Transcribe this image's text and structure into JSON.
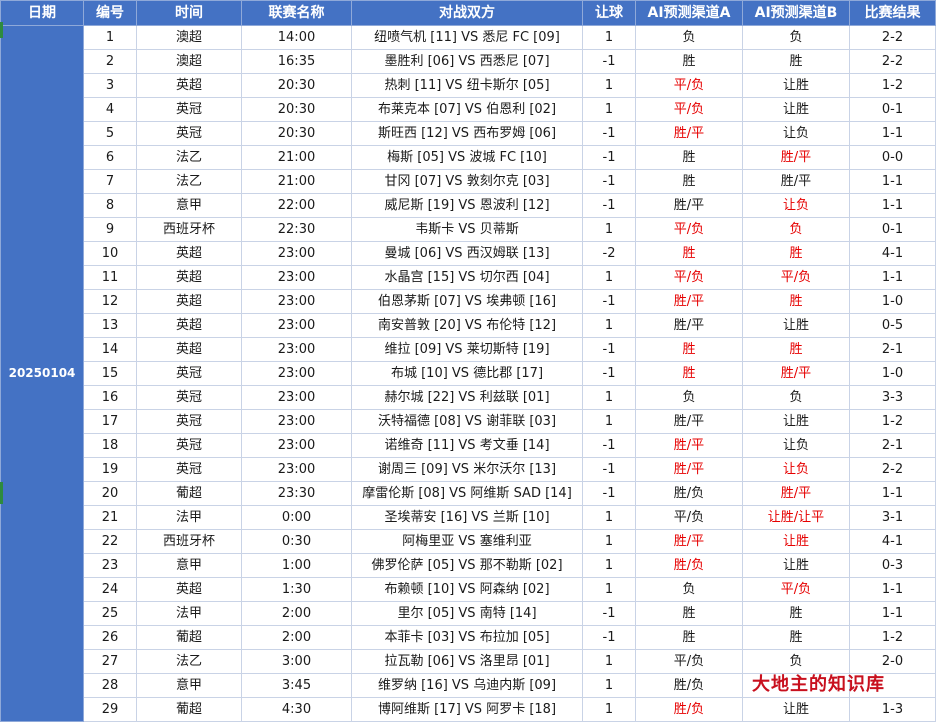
{
  "headers": [
    "日期",
    "编号",
    "时间",
    "联赛名称",
    "对战双方",
    "让球",
    "AI预测渠道A",
    "AI预测渠道B",
    "比赛结果"
  ],
  "date": "20250104",
  "watermark": "大地主的知识库",
  "colors": {
    "header_bg": "#4472c4",
    "highlight_text": "#e60000"
  },
  "rows": [
    {
      "no": "1",
      "time": "14:00",
      "league": "澳超",
      "match": "纽喷气机 [11] VS 悉尼 FC [09]",
      "handicap": "1",
      "a": "负",
      "a_red": false,
      "b": "负",
      "b_red": false,
      "result": "2-2"
    },
    {
      "no": "2",
      "time": "16:35",
      "league": "澳超",
      "match": "墨胜利 [06] VS 西悉尼 [07]",
      "handicap": "-1",
      "a": "胜",
      "a_red": false,
      "b": "胜",
      "b_red": false,
      "result": "2-2"
    },
    {
      "no": "3",
      "time": "20:30",
      "league": "英超",
      "match": "热刺 [11] VS 纽卡斯尔 [05]",
      "handicap": "1",
      "a": "平/负",
      "a_red": true,
      "b": "让胜",
      "b_red": false,
      "result": "1-2"
    },
    {
      "no": "4",
      "time": "20:30",
      "league": "英冠",
      "match": "布莱克本 [07] VS 伯恩利 [02]",
      "handicap": "1",
      "a": "平/负",
      "a_red": true,
      "b": "让胜",
      "b_red": false,
      "result": "0-1"
    },
    {
      "no": "5",
      "time": "20:30",
      "league": "英冠",
      "match": "斯旺西 [12] VS 西布罗姆 [06]",
      "handicap": "-1",
      "a": "胜/平",
      "a_red": true,
      "b": "让负",
      "b_red": false,
      "result": "1-1"
    },
    {
      "no": "6",
      "time": "21:00",
      "league": "法乙",
      "match": "梅斯 [05] VS 波城 FC [10]",
      "handicap": "-1",
      "a": "胜",
      "a_red": false,
      "b": "胜/平",
      "b_red": true,
      "result": "0-0"
    },
    {
      "no": "7",
      "time": "21:00",
      "league": "法乙",
      "match": "甘冈 [07] VS 敦刻尔克 [03]",
      "handicap": "-1",
      "a": "胜",
      "a_red": false,
      "b": "胜/平",
      "b_red": false,
      "result": "1-1"
    },
    {
      "no": "8",
      "time": "22:00",
      "league": "意甲",
      "match": "威尼斯 [19] VS 恩波利 [12]",
      "handicap": "-1",
      "a": "胜/平",
      "a_red": false,
      "b": "让负",
      "b_red": true,
      "result": "1-1"
    },
    {
      "no": "9",
      "time": "22:30",
      "league": "西班牙杯",
      "match": "韦斯卡 VS 贝蒂斯",
      "handicap": "1",
      "a": "平/负",
      "a_red": true,
      "b": "负",
      "b_red": true,
      "result": "0-1"
    },
    {
      "no": "10",
      "time": "23:00",
      "league": "英超",
      "match": "曼城 [06] VS 西汉姆联 [13]",
      "handicap": "-2",
      "a": "胜",
      "a_red": true,
      "b": "胜",
      "b_red": true,
      "result": "4-1"
    },
    {
      "no": "11",
      "time": "23:00",
      "league": "英超",
      "match": "水晶宫 [15] VS 切尔西 [04]",
      "handicap": "1",
      "a": "平/负",
      "a_red": true,
      "b": "平/负",
      "b_red": true,
      "result": "1-1"
    },
    {
      "no": "12",
      "time": "23:00",
      "league": "英超",
      "match": "伯恩茅斯 [07] VS 埃弗顿 [16]",
      "handicap": "-1",
      "a": "胜/平",
      "a_red": true,
      "b": "胜",
      "b_red": true,
      "result": "1-0"
    },
    {
      "no": "13",
      "time": "23:00",
      "league": "英超",
      "match": "南安普敦 [20] VS 布伦特 [12]",
      "handicap": "1",
      "a": "胜/平",
      "a_red": false,
      "b": "让胜",
      "b_red": false,
      "result": "0-5"
    },
    {
      "no": "14",
      "time": "23:00",
      "league": "英超",
      "match": "维拉 [09] VS 莱切斯特 [19]",
      "handicap": "-1",
      "a": "胜",
      "a_red": true,
      "b": "胜",
      "b_red": true,
      "result": "2-1"
    },
    {
      "no": "15",
      "time": "23:00",
      "league": "英冠",
      "match": "布城 [10] VS 德比郡 [17]",
      "handicap": "-1",
      "a": "胜",
      "a_red": true,
      "b": "胜/平",
      "b_red": true,
      "result": "1-0"
    },
    {
      "no": "16",
      "time": "23:00",
      "league": "英冠",
      "match": "赫尔城 [22] VS 利兹联 [01]",
      "handicap": "1",
      "a": "负",
      "a_red": false,
      "b": "负",
      "b_red": false,
      "result": "3-3"
    },
    {
      "no": "17",
      "time": "23:00",
      "league": "英冠",
      "match": "沃特福德 [08] VS 谢菲联 [03]",
      "handicap": "1",
      "a": "胜/平",
      "a_red": false,
      "b": "让胜",
      "b_red": false,
      "result": "1-2"
    },
    {
      "no": "18",
      "time": "23:00",
      "league": "英冠",
      "match": "诺维奇 [11] VS 考文垂 [14]",
      "handicap": "-1",
      "a": "胜/平",
      "a_red": true,
      "b": "让负",
      "b_red": false,
      "result": "2-1"
    },
    {
      "no": "19",
      "time": "23:00",
      "league": "英冠",
      "match": "谢周三 [09] VS 米尔沃尔 [13]",
      "handicap": "-1",
      "a": "胜/平",
      "a_red": true,
      "b": "让负",
      "b_red": true,
      "result": "2-2"
    },
    {
      "no": "20",
      "time": "23:30",
      "league": "葡超",
      "match": "摩雷伦斯 [08] VS 阿维斯 SAD [14]",
      "handicap": "-1",
      "a": "胜/负",
      "a_red": false,
      "b": "胜/平",
      "b_red": true,
      "result": "1-1"
    },
    {
      "no": "21",
      "time": "0:00",
      "league": "法甲",
      "match": "圣埃蒂安 [16] VS 兰斯 [10]",
      "handicap": "1",
      "a": "平/负",
      "a_red": false,
      "b": "让胜/让平",
      "b_red": true,
      "result": "3-1"
    },
    {
      "no": "22",
      "time": "0:30",
      "league": "西班牙杯",
      "match": "阿梅里亚 VS 塞维利亚",
      "handicap": "1",
      "a": "胜/平",
      "a_red": true,
      "b": "让胜",
      "b_red": true,
      "result": "4-1"
    },
    {
      "no": "23",
      "time": "1:00",
      "league": "意甲",
      "match": "佛罗伦萨 [05] VS 那不勒斯 [02]",
      "handicap": "1",
      "a": "胜/负",
      "a_red": true,
      "b": "让胜",
      "b_red": false,
      "result": "0-3"
    },
    {
      "no": "24",
      "time": "1:30",
      "league": "英超",
      "match": "布赖顿 [10] VS 阿森纳 [02]",
      "handicap": "1",
      "a": "负",
      "a_red": false,
      "b": "平/负",
      "b_red": true,
      "result": "1-1"
    },
    {
      "no": "25",
      "time": "2:00",
      "league": "法甲",
      "match": "里尔 [05] VS 南特 [14]",
      "handicap": "-1",
      "a": "胜",
      "a_red": false,
      "b": "胜",
      "b_red": false,
      "result": "1-1"
    },
    {
      "no": "26",
      "time": "2:00",
      "league": "葡超",
      "match": "本菲卡 [03] VS 布拉加 [05]",
      "handicap": "-1",
      "a": "胜",
      "a_red": false,
      "b": "胜",
      "b_red": false,
      "result": "1-2"
    },
    {
      "no": "27",
      "time": "3:00",
      "league": "法乙",
      "match": "拉瓦勒 [06] VS 洛里昂 [01]",
      "handicap": "1",
      "a": "平/负",
      "a_red": false,
      "b": "负",
      "b_red": false,
      "result": "2-0"
    },
    {
      "no": "28",
      "time": "3:45",
      "league": "意甲",
      "match": "维罗纳 [16] VS 乌迪内斯 [09]",
      "handicap": "1",
      "a": "胜/负",
      "a_red": false,
      "b": "",
      "b_red": false,
      "result": ""
    },
    {
      "no": "29",
      "time": "4:30",
      "league": "葡超",
      "match": "博阿维斯 [17] VS 阿罗卡 [18]",
      "handicap": "1",
      "a": "胜/负",
      "a_red": true,
      "b": "让胜",
      "b_red": false,
      "result": "1-3"
    }
  ]
}
